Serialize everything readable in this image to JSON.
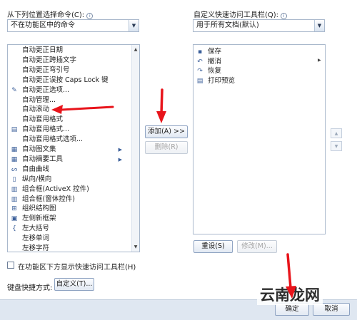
{
  "left_panel": {
    "label": "从下列位置选择命令(C):",
    "info_icon": "info-icon",
    "combo_value": "不在功能区中的命令",
    "items": [
      {
        "label": "自动更正日期",
        "icon": "",
        "submenu": false
      },
      {
        "label": "自动更正跨插文字",
        "icon": "",
        "submenu": false
      },
      {
        "label": "自动更正弯引号",
        "icon": "",
        "submenu": false
      },
      {
        "label": "自动更正误按 Caps Lock 键",
        "icon": "",
        "submenu": false
      },
      {
        "label": "自动更正选项...",
        "icon": "autocorrect-options-icon",
        "submenu": false
      },
      {
        "label": "自动管理...",
        "icon": "",
        "submenu": false
      },
      {
        "label": "自动滚动",
        "icon": "",
        "submenu": false
      },
      {
        "label": "自动套用格式",
        "icon": "",
        "submenu": false
      },
      {
        "label": "自动套用格式...",
        "icon": "autoformat-icon",
        "submenu": false
      },
      {
        "label": "自动套用格式选项...",
        "icon": "",
        "submenu": false
      },
      {
        "label": "自动图文集",
        "icon": "autotext-icon",
        "submenu": true
      },
      {
        "label": "自动摘要工具",
        "icon": "autosummary-icon",
        "submenu": true
      },
      {
        "label": "自由曲线",
        "icon": "freeform-icon",
        "submenu": false
      },
      {
        "label": "纵向/横向",
        "icon": "orientation-icon",
        "submenu": false
      },
      {
        "label": "组合框(ActiveX 控件)",
        "icon": "combobox-activex-icon",
        "submenu": false
      },
      {
        "label": "组合框(窗体控件)",
        "icon": "combobox-form-icon",
        "submenu": false
      },
      {
        "label": "组织结构图",
        "icon": "org-chart-icon",
        "submenu": false
      },
      {
        "label": "左侧新框架",
        "icon": "new-frame-left-icon",
        "submenu": false
      },
      {
        "label": "左大括号",
        "icon": "left-brace-icon",
        "submenu": false
      },
      {
        "label": "左移单词",
        "icon": "",
        "submenu": false
      },
      {
        "label": "左移字符",
        "icon": "",
        "submenu": false
      }
    ]
  },
  "right_panel": {
    "label": "自定义快速访问工具栏(Q):",
    "info_icon": "info-icon",
    "combo_value": "用于所有文档(默认)",
    "items": [
      {
        "label": "保存",
        "icon": "save-icon"
      },
      {
        "label": "撤消",
        "icon": "undo-icon"
      },
      {
        "label": "恢复",
        "icon": "redo-icon"
      },
      {
        "label": "打印预览",
        "icon": "print-preview-icon"
      }
    ]
  },
  "buttons": {
    "add": "添加(A) >>",
    "remove": "删除(R)",
    "reset": "重设(S)",
    "modify": "修改(M)...",
    "customize": "自定义(T)...",
    "ok": "确定",
    "cancel": "取消"
  },
  "checkbox_label": "在功能区下方显示快速访问工具栏(H)",
  "keyboard_label": "键盘快捷方式:",
  "watermark_text": "云南龙网",
  "accent_color": "#e8141b"
}
